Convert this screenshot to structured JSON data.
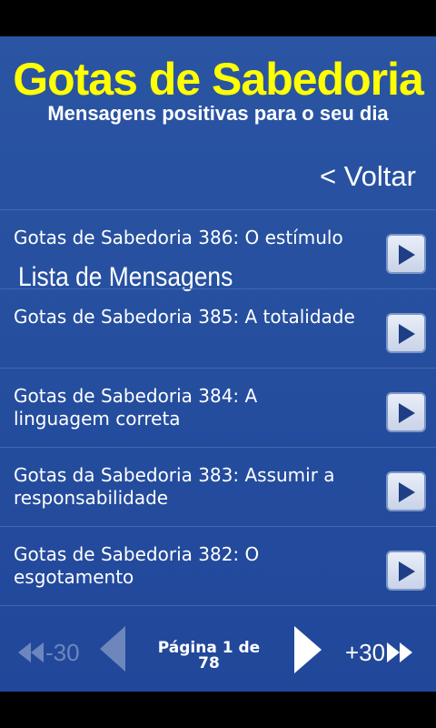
{
  "header": {
    "title": "Gotas de Sabedoria",
    "subtitle": "Mensagens positivas para o seu dia"
  },
  "navbar": {
    "list_title": "Lista de Mensagens",
    "back_label": "< Voltar"
  },
  "messages": [
    {
      "text": "Gotas de Sabedoria 386: O estímulo"
    },
    {
      "text": "Gotas de Sabedoria 385: A totalidade"
    },
    {
      "text": "Gotas de Sabedoria 384: A linguagem correta"
    },
    {
      "text": "Gotas da Sabedoria 383: Assumir a responsabilidade"
    },
    {
      "text": "Gotas de Sabedoria 382: O esgotamento"
    }
  ],
  "pager": {
    "prev30_label": "-30",
    "page_label": "Página 1 de 78",
    "next30_label": "+30"
  },
  "colors": {
    "background": "#2a55a3",
    "title": "#ffff00",
    "disabled": "#6d87bd"
  }
}
